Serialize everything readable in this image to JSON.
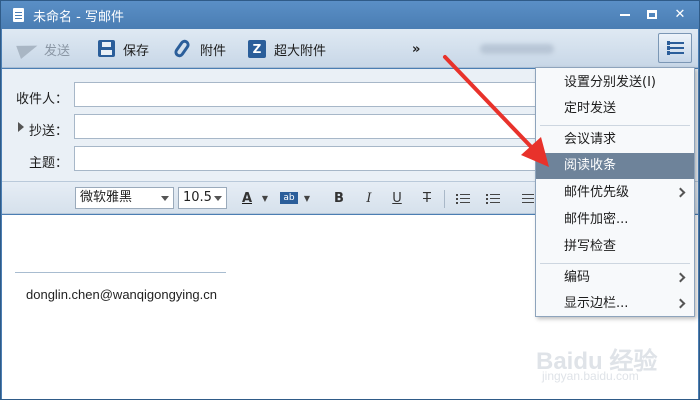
{
  "window": {
    "title": "未命名 - 写邮件"
  },
  "toolbar": {
    "send_label": "发送",
    "save_label": "保存",
    "attach_label": "附件",
    "big_attach_label": "超大附件",
    "more_label": "»"
  },
  "fields": {
    "to_label": "收件人：",
    "cc_label": "抄送：",
    "subject_label": "主题：",
    "to_value": "",
    "cc_value": "",
    "subject_value": ""
  },
  "format": {
    "font_family": "微软雅黑",
    "font_size": "10.5",
    "color_glyph": "A",
    "highlight_glyph": "ab",
    "bold_glyph": "B",
    "italic_glyph": "I",
    "underline_glyph": "U",
    "strike_glyph": "T"
  },
  "editor": {
    "signature": "donglin.chen@wanqigongying.cn"
  },
  "menu": {
    "items": [
      {
        "label": "设置分别发送(I)",
        "submenu": false
      },
      {
        "label": "定时发送",
        "submenu": false
      },
      {
        "label": "会议请求",
        "submenu": false
      },
      {
        "label": "阅读收条",
        "submenu": false,
        "highlighted": true
      },
      {
        "label": "邮件优先级",
        "submenu": true
      },
      {
        "label": "邮件加密...",
        "submenu": false
      },
      {
        "label": "拼写检查",
        "submenu": false
      },
      {
        "label": "编码",
        "submenu": true
      },
      {
        "label": "显示边栏...",
        "submenu": true
      }
    ]
  },
  "colors": {
    "title_bar": "#4a7db3",
    "menu_highlight": "#6e839a",
    "annotation_arrow": "#e8322b",
    "icon_blue": "#2b5e9a"
  }
}
